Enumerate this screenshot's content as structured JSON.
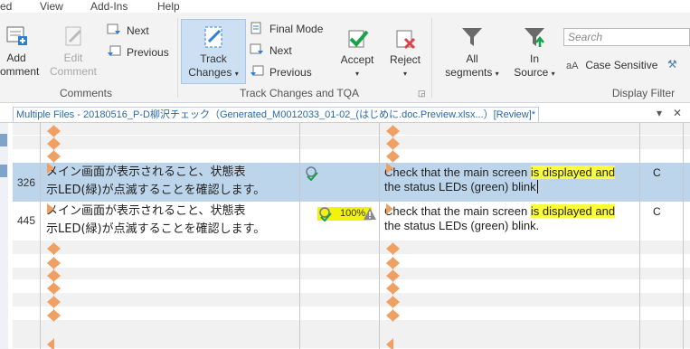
{
  "menu": {
    "items": [
      "ed",
      "View",
      "Add-Ins",
      "Help"
    ]
  },
  "ribbon": {
    "comments": {
      "add_comment": [
        "Add",
        "omment"
      ],
      "edit_comment": [
        "Edit",
        "Comment"
      ],
      "next": "Next",
      "previous": "Previous",
      "group_label": "Comments"
    },
    "track": {
      "track_changes": [
        "Track",
        "Changes"
      ],
      "final_mode": "Final Mode",
      "next": "Next",
      "previous": "Previous",
      "accept": "Accept",
      "reject": "Reject",
      "group_label": "Track Changes and TQA"
    },
    "filter": {
      "all_segments": [
        "All",
        "segments"
      ],
      "in_source": [
        "In",
        "Source"
      ],
      "case_sensitive": "Case Sensitive",
      "search_placeholder": "Search",
      "group_label": "Display Filter"
    }
  },
  "document": {
    "tab_title": "Multiple Files - 20180516_P-D柳沢チェック（Generated_M0012033_01-02_(はじめに.doc.Preview.xlsx...）[Review]*",
    "close": "✕",
    "dropdown": "▾"
  },
  "segments": [
    {
      "number": "326",
      "source_line1": "メイン画面が表示されること、状態表",
      "source_line2": "示LED(緑)が点滅することを確認します。",
      "target_pre": "Check that the main screen ",
      "target_hl": "is displayed and",
      "target_line2": "the status LEDs (green) blink",
      "status": "C",
      "match": ""
    },
    {
      "number": "445",
      "source_line1": "メイン画面が表示されること、状態表",
      "source_line2": "示LED(緑)が点滅することを確認します。",
      "target_pre": "Check that the main screen ",
      "target_hl": "is displayed and",
      "target_line2": "the status LEDs (green) blink.",
      "status": "C",
      "match": "100%"
    }
  ],
  "colors": {
    "accent": "#2b68a8",
    "selected_row": "#bcd5ea",
    "highlight": "#fcfc3a",
    "tag": "#f0a062"
  }
}
